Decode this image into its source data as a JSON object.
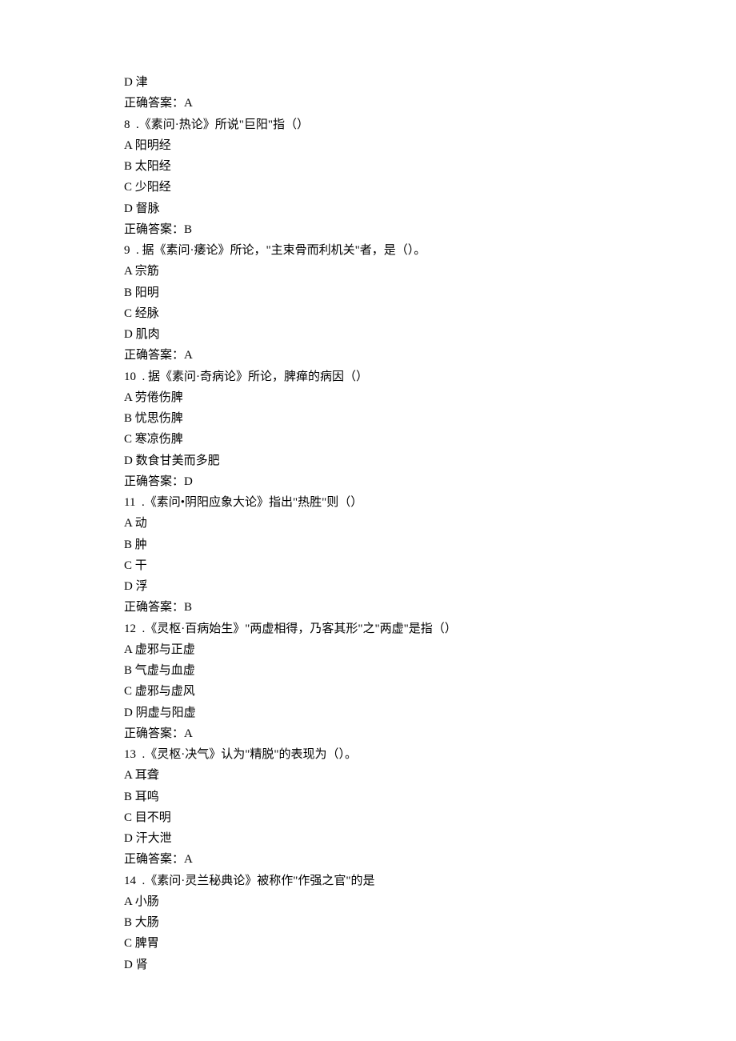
{
  "q7": {
    "optD": "D 津",
    "answer": "正确答案：A"
  },
  "q8": {
    "stem": "8  .《素问·热论》所说\"巨阳\"指（）",
    "optA": "A 阳明经",
    "optB": "B 太阳经",
    "optC": "C 少阳经",
    "optD": "D 督脉",
    "answer": "正确答案：B"
  },
  "q9": {
    "stem": "9  . 据《素问·痿论》所论，\"主束骨而利机关\"者，是（）。",
    "optA": "A 宗筋",
    "optB": "B 阳明",
    "optC": "C 经脉",
    "optD": "D 肌肉",
    "answer": "正确答案：A"
  },
  "q10": {
    "stem": "10  . 据《素问·奇病论》所论，脾瘅的病因（）",
    "optA": "A 劳倦伤脾",
    "optB": "B 忧思伤脾",
    "optC": "C 寒凉伤脾",
    "optD": "D 数食甘美而多肥",
    "answer": "正确答案：D"
  },
  "q11": {
    "stem": "11  .《素问•阴阳应象大论》指出\"热胜\"则（）",
    "optA": "A 动",
    "optB": "B 肿",
    "optC": "C 干",
    "optD": "D 浮",
    "answer": "正确答案：B"
  },
  "q12": {
    "stem": "12  .《灵枢·百病始生》\"两虚相得，乃客其形\"之\"两虚\"是指（）",
    "optA": "A 虚邪与正虚",
    "optB": "B 气虚与血虚",
    "optC": "C 虚邪与虚风",
    "optD": "D 阴虚与阳虚",
    "answer": "正确答案：A"
  },
  "q13": {
    "stem": "13  .《灵枢·决气》认为\"精脱\"的表现为（）。",
    "optA": "A 耳聋",
    "optB": "B 耳鸣",
    "optC": "C 目不明",
    "optD": "D 汗大泄",
    "answer": "正确答案：A"
  },
  "q14": {
    "stem": "14  .《素问·灵兰秘典论》被称作\"作强之官\"的是",
    "optA": "A 小肠",
    "optB": "B 大肠",
    "optC": "C 脾胃",
    "optD": "D 肾"
  }
}
